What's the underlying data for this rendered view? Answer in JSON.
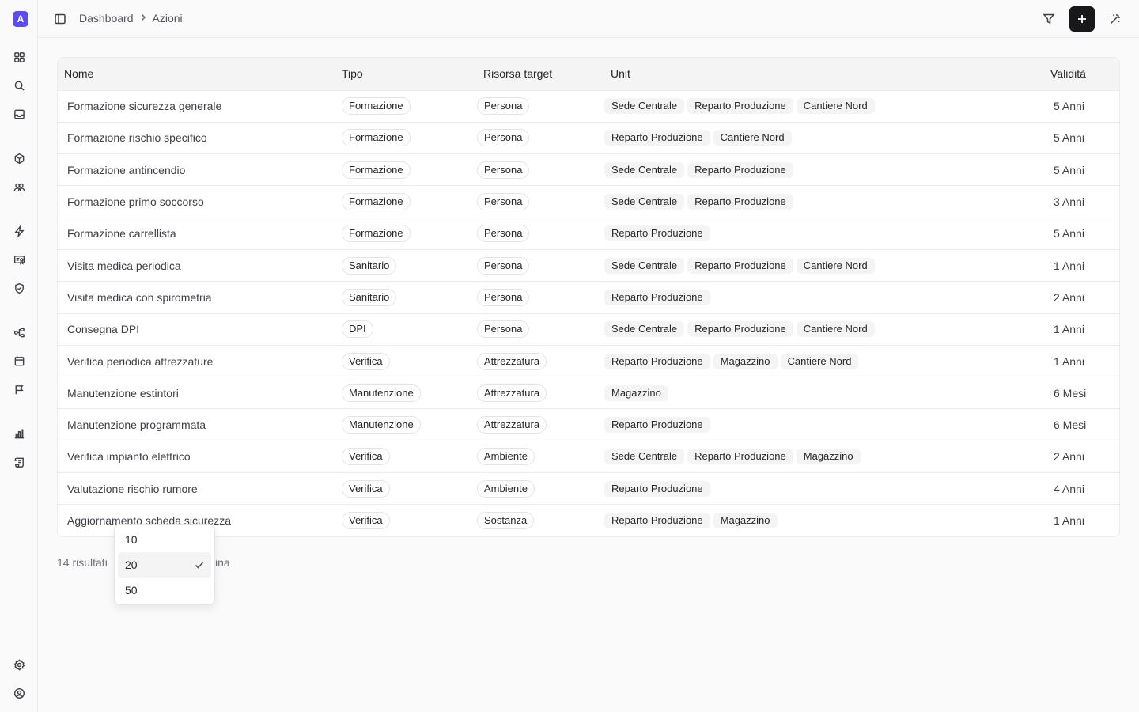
{
  "sidebar": {
    "logo_letter": "A",
    "accent_color": "#5b4ef0",
    "icons": [
      "grid-icon",
      "search-icon",
      "inbox-icon",
      "box-icon",
      "users-icon",
      "zap-icon",
      "badge-check-icon",
      "shield-icon",
      "workflow-icon",
      "calendar-icon",
      "flag-icon",
      "chart-icon",
      "scroll-icon",
      "settings-icon",
      "user-circle-icon"
    ]
  },
  "topbar": {
    "breadcrumb": [
      "Dashboard",
      "Azioni"
    ]
  },
  "table": {
    "headers": {
      "nome": "Nome",
      "tipo": "Tipo",
      "risorsa": "Risorsa target",
      "unit": "Unit",
      "validita": "Validità"
    },
    "rows": [
      {
        "nome": "Formazione sicurezza generale",
        "tipo": "Formazione",
        "risorsa": "Persona",
        "units": [
          "Sede Centrale",
          "Reparto Produzione",
          "Cantiere Nord"
        ],
        "validita": "5 Anni"
      },
      {
        "nome": "Formazione rischio specifico",
        "tipo": "Formazione",
        "risorsa": "Persona",
        "units": [
          "Reparto Produzione",
          "Cantiere Nord"
        ],
        "validita": "5 Anni"
      },
      {
        "nome": "Formazione antincendio",
        "tipo": "Formazione",
        "risorsa": "Persona",
        "units": [
          "Sede Centrale",
          "Reparto Produzione"
        ],
        "validita": "5 Anni"
      },
      {
        "nome": "Formazione primo soccorso",
        "tipo": "Formazione",
        "risorsa": "Persona",
        "units": [
          "Sede Centrale",
          "Reparto Produzione"
        ],
        "validita": "3 Anni"
      },
      {
        "nome": "Formazione carrellista",
        "tipo": "Formazione",
        "risorsa": "Persona",
        "units": [
          "Reparto Produzione"
        ],
        "validita": "5 Anni"
      },
      {
        "nome": "Visita medica periodica",
        "tipo": "Sanitario",
        "risorsa": "Persona",
        "units": [
          "Sede Centrale",
          "Reparto Produzione",
          "Cantiere Nord"
        ],
        "validita": "1 Anni"
      },
      {
        "nome": "Visita medica con spirometria",
        "tipo": "Sanitario",
        "risorsa": "Persona",
        "units": [
          "Reparto Produzione"
        ],
        "validita": "2 Anni"
      },
      {
        "nome": "Consegna DPI",
        "tipo": "DPI",
        "risorsa": "Persona",
        "units": [
          "Sede Centrale",
          "Reparto Produzione",
          "Cantiere Nord"
        ],
        "validita": "1 Anni"
      },
      {
        "nome": "Verifica periodica attrezzature",
        "tipo": "Verifica",
        "risorsa": "Attrezzatura",
        "units": [
          "Reparto Produzione",
          "Magazzino",
          "Cantiere Nord"
        ],
        "validita": "1 Anni"
      },
      {
        "nome": "Manutenzione estintori",
        "tipo": "Manutenzione",
        "risorsa": "Attrezzatura",
        "units": [
          "Magazzino"
        ],
        "validita": "6 Mesi"
      },
      {
        "nome": "Manutenzione programmata",
        "tipo": "Manutenzione",
        "risorsa": "Attrezzatura",
        "units": [
          "Reparto Produzione"
        ],
        "validita": "6 Mesi"
      },
      {
        "nome": "Verifica impianto elettrico",
        "tipo": "Verifica",
        "risorsa": "Ambiente",
        "units": [
          "Sede Centrale",
          "Reparto Produzione",
          "Magazzino"
        ],
        "validita": "2 Anni"
      },
      {
        "nome": "Valutazione rischio rumore",
        "tipo": "Verifica",
        "risorsa": "Ambiente",
        "units": [
          "Reparto Produzione"
        ],
        "validita": "4 Anni"
      },
      {
        "nome": "Aggiornamento scheda sicurezza",
        "tipo": "Verifica",
        "risorsa": "Sostanza",
        "units": [
          "Reparto Produzione",
          "Magazzino"
        ],
        "validita": "1 Anni"
      }
    ]
  },
  "footer": {
    "results": "14 risultati",
    "tail": "ina"
  },
  "page_size_dropdown": {
    "options": [
      "10",
      "20",
      "50"
    ],
    "selected": "20"
  }
}
